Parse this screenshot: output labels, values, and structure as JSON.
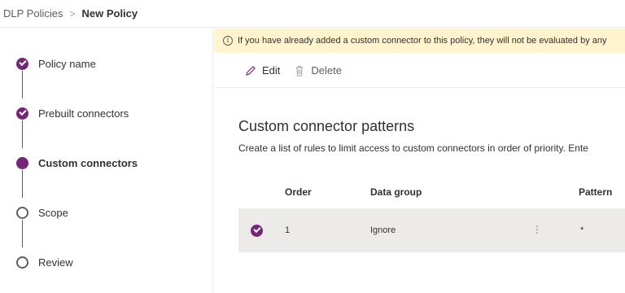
{
  "breadcrumb": {
    "parent": "DLP Policies",
    "separator": ">",
    "current": "New Policy"
  },
  "stepper": {
    "steps": [
      {
        "label": "Policy name",
        "state": "done"
      },
      {
        "label": "Prebuilt connectors",
        "state": "done"
      },
      {
        "label": "Custom connectors",
        "state": "current"
      },
      {
        "label": "Scope",
        "state": "todo"
      },
      {
        "label": "Review",
        "state": "todo"
      }
    ]
  },
  "banner": {
    "icon": "info-icon",
    "text": "If you have already added a custom connector to this policy, they will not be evaluated by any"
  },
  "toolbar": {
    "edit_label": "Edit",
    "delete_label": "Delete"
  },
  "section": {
    "title": "Custom connector patterns",
    "description": "Create a list of rules to limit access to custom connectors in order of priority. Ente"
  },
  "table": {
    "columns": [
      "Order",
      "Data group",
      "Pattern"
    ],
    "rows": [
      {
        "selected": true,
        "order": "1",
        "data_group": "Ignore",
        "pattern": "*"
      }
    ]
  },
  "colors": {
    "accent": "#742774",
    "banner_bg": "#fff4ce",
    "row_selected_bg": "#edebe9"
  }
}
